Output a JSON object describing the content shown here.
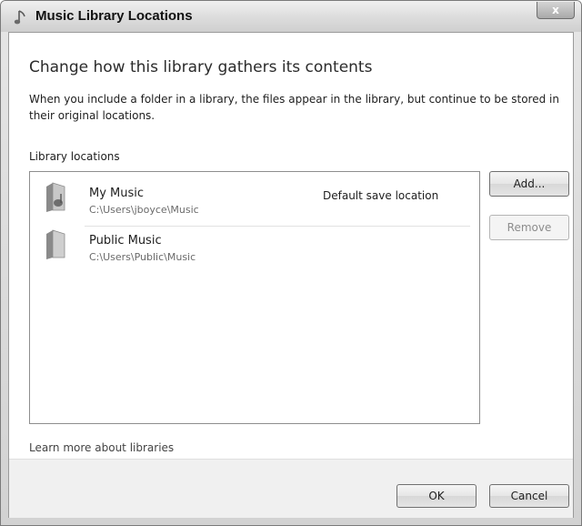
{
  "window": {
    "title": "Music Library Locations",
    "close_symbol": "x",
    "icons": {
      "app": "music-note-icon",
      "close": "close-icon"
    }
  },
  "main": {
    "heading": "Change how this library gathers its contents",
    "description": "When you include a folder in a library, the files appear in the library, but continue to be stored in their original locations.",
    "locations_label": "Library locations",
    "locations": [
      {
        "name": "My Music",
        "path": "C:\\Users\\jboyce\\Music",
        "badge": "Default save location",
        "icon": "music-folder-icon"
      },
      {
        "name": "Public Music",
        "path": "C:\\Users\\Public\\Music",
        "badge": "",
        "icon": "folder-icon"
      }
    ],
    "add_label": "Add...",
    "remove_label": "Remove",
    "learn_more": "Learn more about libraries"
  },
  "footer": {
    "ok_label": "OK",
    "cancel_label": "Cancel"
  },
  "colors": {
    "link": "#444444",
    "disabled_text": "#8d8d8d"
  }
}
